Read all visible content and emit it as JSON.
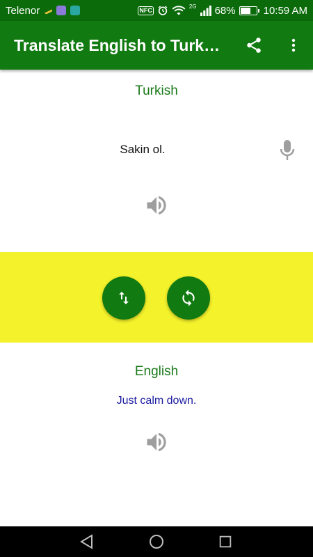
{
  "status_bar": {
    "carrier": "Telenor",
    "nfc": "NFC",
    "network": "2G",
    "battery": "68%",
    "battery_level": 0.68,
    "time": "10:59 AM"
  },
  "app_bar": {
    "title": "Translate English to Turkish",
    "actions": [
      "share-icon",
      "more-vert-icon"
    ]
  },
  "source": {
    "language": "Turkish",
    "text": "Sakin ol."
  },
  "target": {
    "language": "English",
    "text": "Just calm down."
  },
  "colors": {
    "status_bar": "#0b6b0b",
    "app_bar": "#117a11",
    "accent_yellow": "#f4f22a",
    "label_green": "#1a7a1a",
    "translation_blue": "#1a1aa0",
    "icon_gray": "#9e9e9e"
  },
  "nav_bar": [
    "back-icon",
    "home-icon",
    "recents-icon"
  ]
}
